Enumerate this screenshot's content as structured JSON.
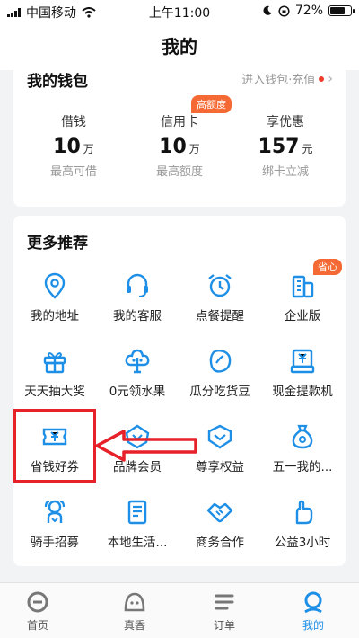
{
  "status_bar": {
    "carrier": "中国移动",
    "time": "上午11:00",
    "battery": "72%"
  },
  "nav": {
    "title": "我的"
  },
  "wallet": {
    "title": "我的钱包",
    "link": "进入钱包·充值",
    "badge": "高额度",
    "items": [
      {
        "label": "借钱",
        "value": "10",
        "unit": "万",
        "sub": "最高可借"
      },
      {
        "label": "信用卡",
        "value": "10",
        "unit": "万",
        "sub": "最高额度"
      },
      {
        "label": "享优惠",
        "value": "157",
        "unit": "元",
        "sub": "绑卡立减"
      }
    ]
  },
  "recommend": {
    "title": "更多推荐",
    "badge": "省心",
    "items": [
      {
        "label": "我的地址",
        "icon": "location-icon"
      },
      {
        "label": "我的客服",
        "icon": "headset-icon"
      },
      {
        "label": "点餐提醒",
        "icon": "alarm-clock-icon"
      },
      {
        "label": "企业版",
        "icon": "building-icon"
      },
      {
        "label": "天天抽大奖",
        "icon": "gift-icon"
      },
      {
        "label": "0元领水果",
        "icon": "tree-icon"
      },
      {
        "label": "瓜分吃货豆",
        "icon": "bean-icon"
      },
      {
        "label": "现金提款机",
        "icon": "cash-machine-icon"
      },
      {
        "label": "省钱好券",
        "icon": "coupon-icon"
      },
      {
        "label": "品牌会员",
        "icon": "diamond-icon"
      },
      {
        "label": "尊享权益",
        "icon": "crown-icon"
      },
      {
        "label": "五一我的...",
        "icon": "money-bag-icon"
      },
      {
        "label": "骑手招募",
        "icon": "rider-icon"
      },
      {
        "label": "本地生活...",
        "icon": "document-icon"
      },
      {
        "label": "商务合作",
        "icon": "handshake-icon"
      },
      {
        "label": "公益3小时",
        "icon": "charity-hand-icon"
      }
    ]
  },
  "tabs": [
    {
      "label": "首页",
      "icon": "home-icon"
    },
    {
      "label": "真香",
      "icon": "discover-icon"
    },
    {
      "label": "订单",
      "icon": "orders-icon"
    },
    {
      "label": "我的",
      "icon": "profile-icon"
    }
  ],
  "colors": {
    "accent": "#1e8fe6",
    "badge": "#f56a34",
    "annotation": "#e62129",
    "background": "#f2f3f5"
  }
}
